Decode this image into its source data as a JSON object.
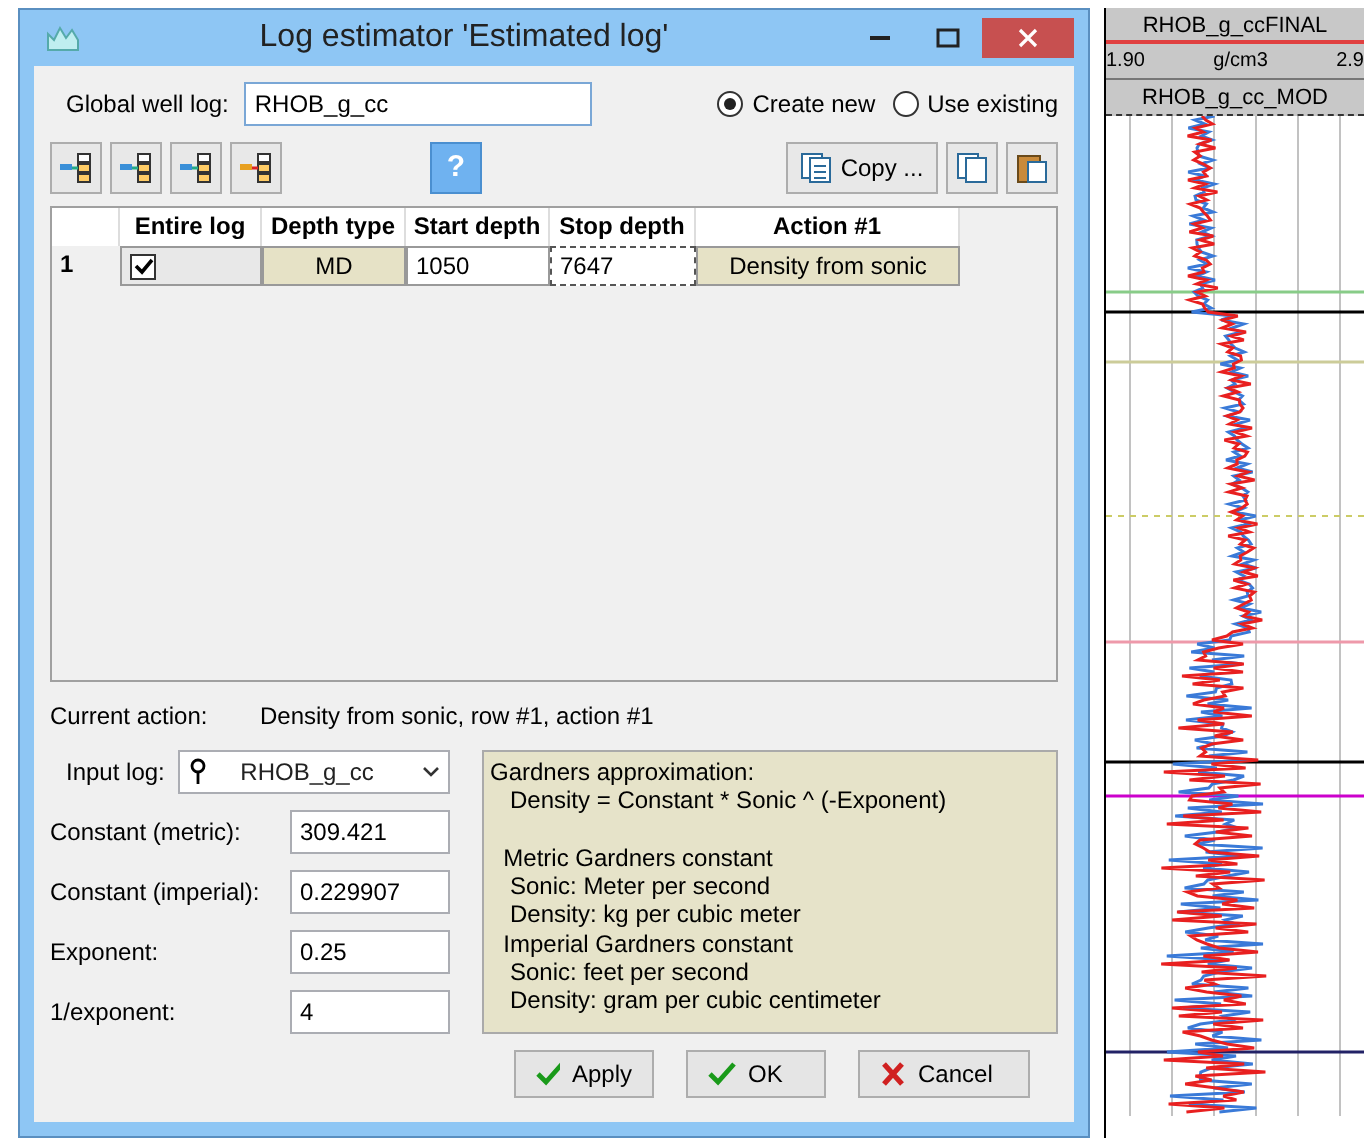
{
  "window": {
    "title": "Log estimator 'Estimated log'"
  },
  "global_well_log": {
    "label": "Global well log:",
    "value": "RHOB_g_cc"
  },
  "mode_options": [
    {
      "label": "Create new",
      "selected": true
    },
    {
      "label": "Use existing",
      "selected": false
    }
  ],
  "help_button": {
    "label": "?"
  },
  "copy_button": {
    "label": "Copy ..."
  },
  "table": {
    "columns": [
      "Entire log",
      "Depth type",
      "Start depth",
      "Stop depth",
      "Action #1"
    ],
    "rows": [
      {
        "number": "1",
        "entire_log": true,
        "depth_type": "MD",
        "start_depth": "1050",
        "stop_depth": "7647",
        "action": "Density from sonic"
      }
    ]
  },
  "current_action": {
    "label": "Current action:",
    "value": "Density from sonic, row #1, action #1"
  },
  "input_log": {
    "label": "Input log:",
    "value": "RHOB_g_cc"
  },
  "parameters": [
    {
      "label": "Constant (metric):",
      "value": "309.421"
    },
    {
      "label": "Constant (imperial):",
      "value": "0.229907"
    },
    {
      "label": "Exponent:",
      "value": "0.25"
    },
    {
      "label": "1/exponent:",
      "value": "4"
    }
  ],
  "info_text": "Gardners approximation:\n   Density = Constant * Sonic ^ (-Exponent)\n\n  Metric Gardners constant\n   Sonic: Meter per second\n   Density: kg per cubic meter\n  Imperial Gardners constant\n   Sonic: feet per second\n   Density: gram per cubic centimeter",
  "buttons": [
    {
      "label": "Apply",
      "kind": "ok"
    },
    {
      "label": "OK",
      "kind": "ok"
    },
    {
      "label": "Cancel",
      "kind": "cancel"
    }
  ],
  "log_track": {
    "title": "RHOB_g_ccFINAL",
    "scale_min": "1.90",
    "unit": "g/cm3",
    "scale_max": "2.9",
    "curve_name": "RHOB_g_cc_MOD"
  }
}
